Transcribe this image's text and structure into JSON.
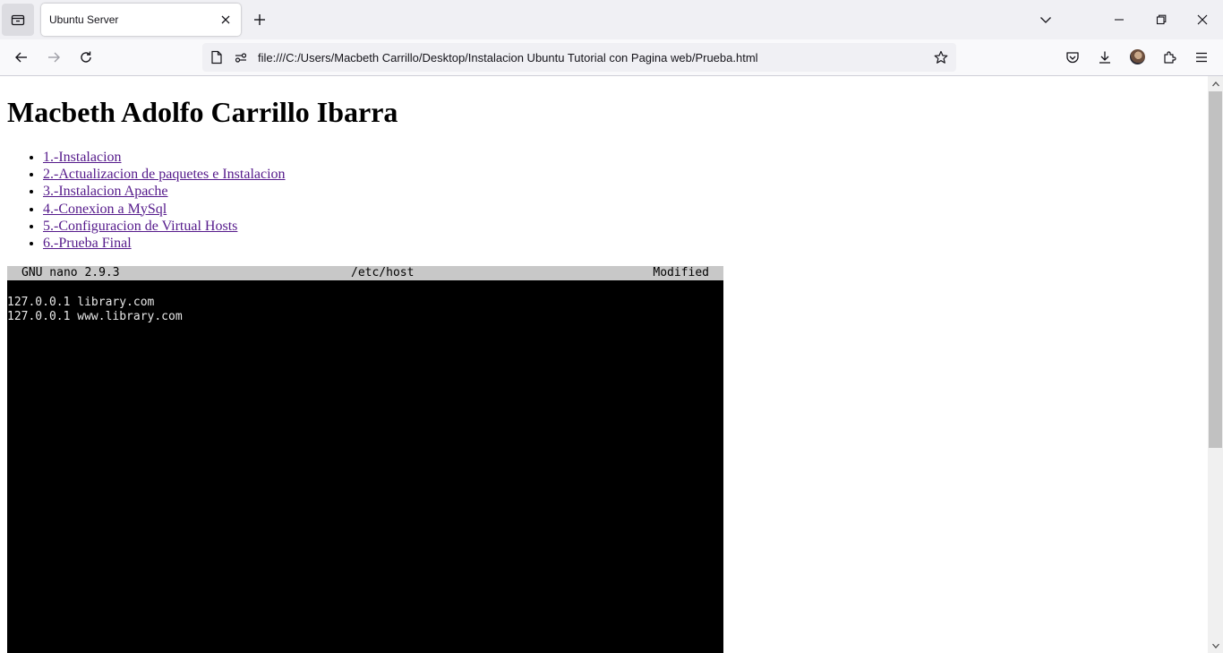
{
  "browser": {
    "tab_title": "Ubuntu Server",
    "url": "file:///C:/Users/Macbeth Carrillo/Desktop/Instalacion Ubuntu Tutorial con Pagina web/Prueba.html"
  },
  "page": {
    "title": "Macbeth Adolfo Carrillo Ibarra",
    "toc": [
      "1.-Instalacion",
      "2.-Actualizacion de paquetes e Instalacion",
      "3.-Instalacion Apache",
      "4.-Conexion a MySql",
      "5.-Configuracion de Virtual Hosts",
      "6.-Prueba Final"
    ]
  },
  "terminal": {
    "app": "GNU nano 2.9.3",
    "file": "/etc/host",
    "status": "Modified",
    "lines": [
      "127.0.0.1 library.com",
      "127.0.0.1 www.library.com"
    ]
  },
  "icons": {
    "tab_list": "tab-list-icon",
    "close_tab": "close-icon",
    "new_tab": "plus-icon",
    "back": "back-arrow-icon",
    "forward": "forward-arrow-icon",
    "reload": "reload-icon",
    "page": "page-icon",
    "permissions": "permissions-icon",
    "bookmark": "star-icon",
    "pocket": "pocket-icon",
    "downloads": "download-icon",
    "account": "avatar-icon",
    "extensions": "puzzle-icon",
    "menu": "hamburger-icon"
  },
  "colors": {
    "link_visited": "#551a8b",
    "terminal_bg": "#000000",
    "nano_bar": "#c8c8c8"
  }
}
